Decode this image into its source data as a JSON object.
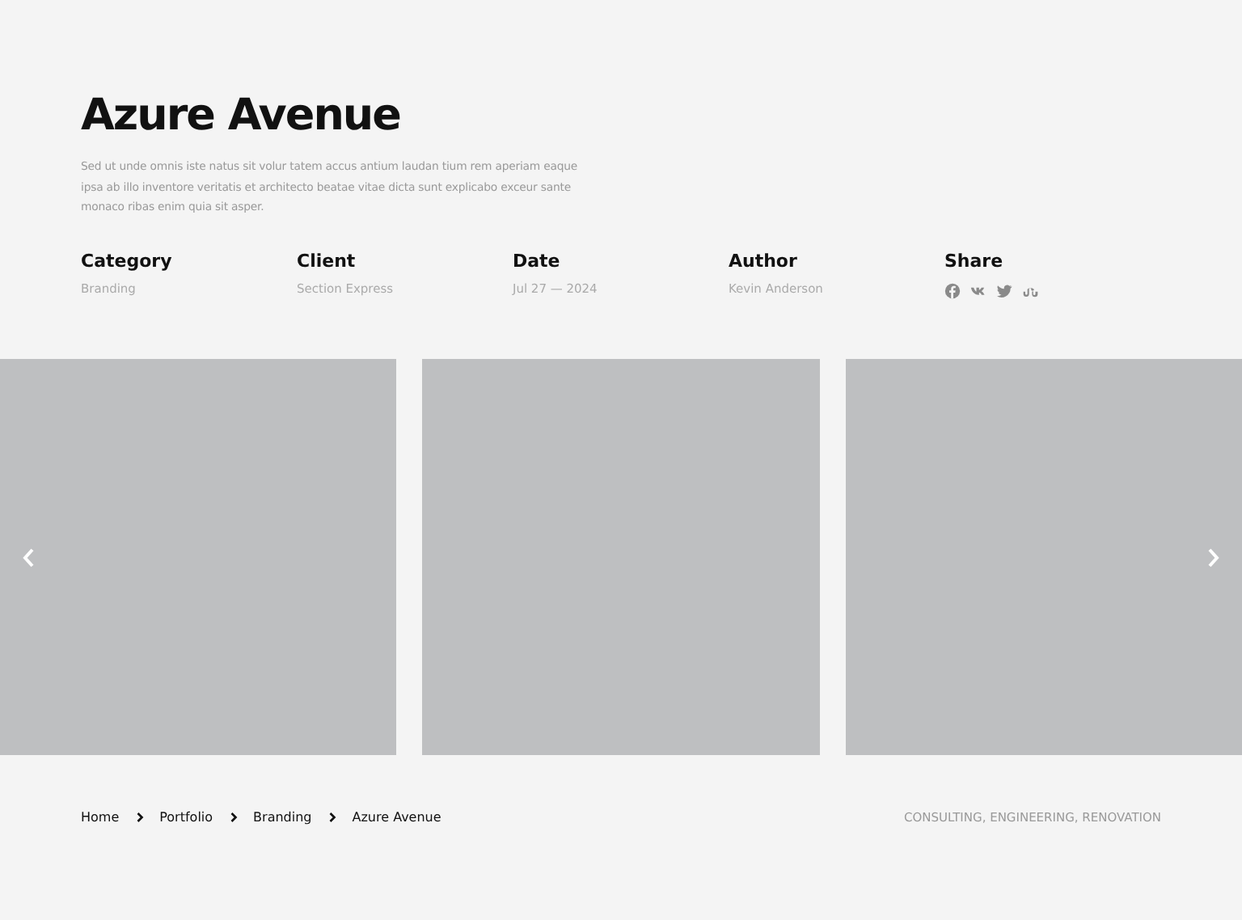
{
  "project": {
    "title": "Azure Avenue",
    "description": "Sed ut unde omnis iste natus sit volur tatem accus antium laudan tium rem aperiam eaque ipsa ab illo inventore veritatis et architecto beatae vitae dicta sunt explicabo exceur sante monaco ribas enim quia sit asper."
  },
  "meta": [
    {
      "label": "Category",
      "value": "Branding"
    },
    {
      "label": "Client",
      "value": "Section Express"
    },
    {
      "label": "Date",
      "value": "Jul 27 — 2024"
    },
    {
      "label": "Author",
      "value": "Kevin Anderson"
    }
  ],
  "share": {
    "label": "Share",
    "icons": [
      {
        "kind": "facebook"
      },
      {
        "kind": "vk"
      },
      {
        "kind": "twitter"
      },
      {
        "kind": "stumbleupon"
      }
    ]
  },
  "breadcrumb": [
    "Home",
    "Portfolio",
    "Branding",
    "Azure Avenue"
  ],
  "tags": "CONSULTING, ENGINEERING, RENOVATION"
}
